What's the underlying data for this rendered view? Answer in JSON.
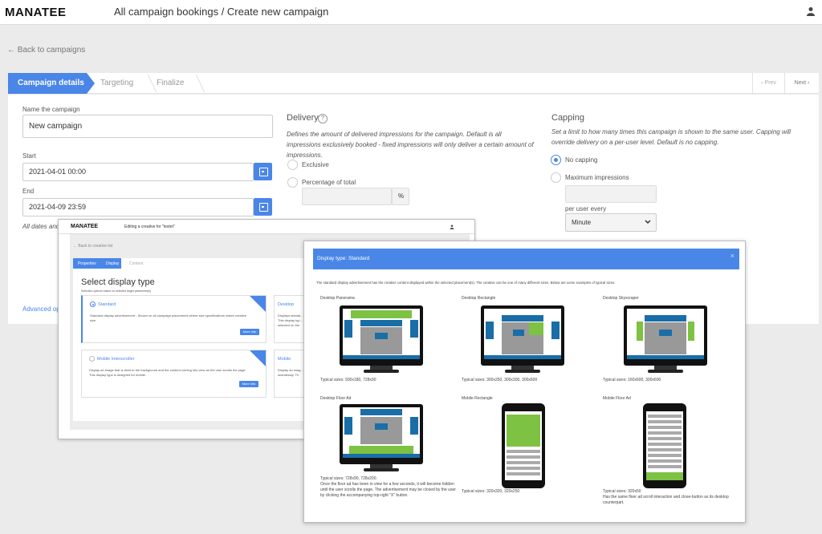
{
  "app": {
    "logo": "MANATEE",
    "breadcrumb": "All campaign bookings / Create new campaign"
  },
  "back_link": "← Back to campaigns",
  "steps": [
    "Campaign details",
    "Targeting",
    "Finalize"
  ],
  "pager": {
    "prev": "‹ Prev",
    "next": "Next ›"
  },
  "form": {
    "name_label": "Name the campaign",
    "name_value": "New campaign",
    "start_label": "Start",
    "start_value": "2021-04-01 00:00",
    "end_label": "End",
    "end_value": "2021-04-09 23:59",
    "all_dates_note": "All dates and",
    "advanced": "Advanced op"
  },
  "delivery": {
    "title": "Delivery",
    "help": "?",
    "desc": "Defines the amount of delivered impressions for the campaign. Default is all impressions exclusively booked - fixed impressions will only deliver a certain amount of impressions.",
    "opt_exclusive": "Exclusive",
    "opt_percentage": "Percentage of total",
    "unit": "%"
  },
  "capping": {
    "title": "Capping",
    "desc": "Set a limit to how many times this campaign is shown to the same user. Capping will override delivery on a per-user level. Default is no capping.",
    "opt_none": "No capping",
    "opt_max": "Maximum impressions",
    "per_user_label": "per user every",
    "per_user_value": "Minute"
  },
  "overlay1": {
    "logo": "MANATEE",
    "title": "Editing a creative for \"testet\"",
    "back": "← Back to creative list",
    "steps": [
      "Properties",
      "Display",
      "Content"
    ],
    "heading": "Select display type",
    "subheading": "Selection options based on selected target placement(s)",
    "cards": [
      {
        "title": "Standard",
        "desc": "Standard display advertisement - Shown on all campaign placements where size specifications match creative size.",
        "btn": "More info"
      },
      {
        "title": "Desktop",
        "desc": "Displays standa... This display typ... selected on the",
        "btn": ""
      },
      {
        "title": "Mobile Interscroller",
        "desc": "Display an image that is fixed to the background and the content coming into view as the user scrolls the page. This display type is designed for mobile.",
        "btn": "More info"
      },
      {
        "title": "Mobile",
        "desc": "Display an imag... seamlessly. Th",
        "btn": ""
      }
    ]
  },
  "overlay2": {
    "header": "Display type: Standard",
    "close": "×",
    "intro": "The standard display advertisement has the creative content displayed within the selected placement(s). The creative can be one of many different sizes. Below are some examples of typical sizes.",
    "examples": [
      {
        "name": "Desktop Panorama",
        "sizes": "Typical sizes: 930x180, 728x90"
      },
      {
        "name": "Desktop Rectangle",
        "sizes": "Typical sizes: 300x250, 300x300, 300x600"
      },
      {
        "name": "Desktop Skyscraper",
        "sizes": "Typical sizes: 160x600, 300x600"
      },
      {
        "name": "Desktop Floor Ad",
        "sizes": "Typical sizes: 728x90, 728x200.\nOnce the floor ad has been in view for a few seconds, it will become hidden until the user scrolls the page. The advertisement may be closed by the user by clicking the accompanying top-right \"X\" button."
      },
      {
        "name": "Mobile Rectangle",
        "sizes": "Typical sizes: 320x320, 320x250"
      },
      {
        "name": "Mobile Floor Ad",
        "sizes": "Typical sizes: 320x50\nHas the same floor ad scroll interaction and close-button as its desktop counterpart."
      }
    ]
  },
  "colors": {
    "accent": "#4a86e8",
    "ad_green": "#7dc242",
    "ad_blue": "#1a6ea8"
  },
  "icons": [
    "user-icon",
    "calendar-icon",
    "help-icon",
    "chevron-down-icon",
    "close-icon"
  ]
}
